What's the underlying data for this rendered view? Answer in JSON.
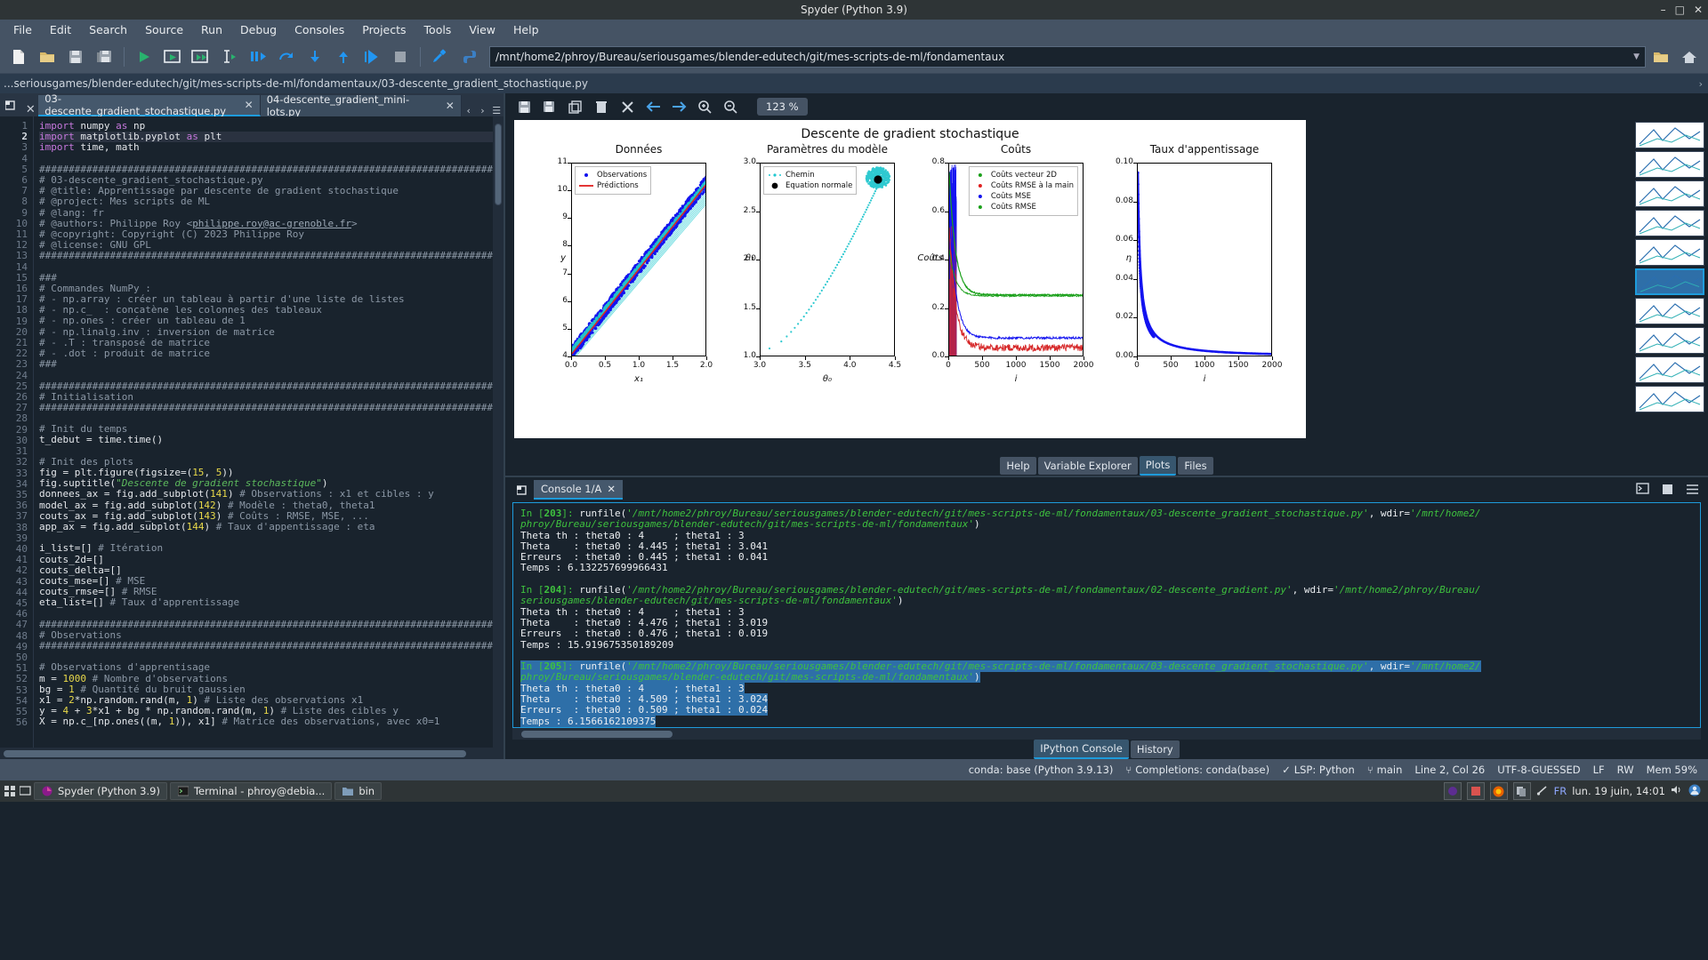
{
  "window": {
    "title": "Spyder (Python 3.9)",
    "minimize": "–",
    "maximize": "□",
    "close": "✕"
  },
  "menubar": {
    "items": [
      "File",
      "Edit",
      "Search",
      "Source",
      "Run",
      "Debug",
      "Consoles",
      "Projects",
      "Tools",
      "View",
      "Help"
    ]
  },
  "toolbar": {
    "icons": [
      "new-file",
      "open-file",
      "save-file",
      "save-all",
      "run-file",
      "run-cell",
      "run-cell-advance",
      "run-selection",
      "debug-file",
      "debug-step",
      "debug-continue",
      "debug-stop",
      "debug-exit",
      "preferences",
      "python-path"
    ],
    "path_value": "/mnt/home2/phroy/Bureau/seriousgames/blender-edutech/git/mes-scripts-de-ml/fondamentaux",
    "browse_label": "browse-directory",
    "home_label": "home-directory"
  },
  "pathstrip": {
    "text": "...seriousgames/blender-edutech/git/mes-scripts-de-ml/fondamentaux/03-descente_gradient_stochastique.py"
  },
  "editor": {
    "tabs": [
      {
        "label": "03-descente_gradient_stochastique.py",
        "active": true
      },
      {
        "label": "04-descente_gradient_mini-lots.py",
        "active": false
      }
    ],
    "current_line": 2,
    "lines": [
      {
        "n": 1,
        "html": "<span class='kw'>import</span> numpy <span class='kw'>as</span> np"
      },
      {
        "n": 2,
        "html": "<span class='kw'>import</span> matplotlib.pyplot <span class='kw'>as</span> plt"
      },
      {
        "n": 3,
        "html": "<span class='kw'>import</span> time, math"
      },
      {
        "n": 4,
        "html": ""
      },
      {
        "n": 5,
        "html": "<span class='cm'>###############################################################################</span>"
      },
      {
        "n": 6,
        "html": "<span class='cm'># 03-descente_gradient_stochastique.py</span>"
      },
      {
        "n": 7,
        "html": "<span class='cm'># @title: Apprentissage par descente de gradient stochastique</span>"
      },
      {
        "n": 8,
        "html": "<span class='cm'># @project: Mes scripts de ML</span>"
      },
      {
        "n": 9,
        "html": "<span class='cm'># @lang: fr</span>"
      },
      {
        "n": 10,
        "html": "<span class='cm'># @authors: Philippe Roy &lt;<span class='lnk'>philippe.roy@ac-grenoble.fr</span>&gt;</span>"
      },
      {
        "n": 11,
        "html": "<span class='cm'># @copyright: Copyright (C) 2023 Philippe Roy</span>"
      },
      {
        "n": 12,
        "html": "<span class='cm'># @license: GNU GPL</span>"
      },
      {
        "n": 13,
        "html": "<span class='cm'>###############################################################################</span>"
      },
      {
        "n": 14,
        "html": ""
      },
      {
        "n": 15,
        "html": "<span class='cm'>###</span>"
      },
      {
        "n": 16,
        "html": "<span class='cm'># Commandes NumPy :</span>"
      },
      {
        "n": 17,
        "html": "<span class='cm'># - np.array : créer un tableau à partir d'une liste de listes</span>"
      },
      {
        "n": 18,
        "html": "<span class='cm'># - np.c_  : concatène les colonnes des tableaux</span>"
      },
      {
        "n": 19,
        "html": "<span class='cm'># - np.ones : créer un tableau de 1</span>"
      },
      {
        "n": 20,
        "html": "<span class='cm'># - np.linalg.inv : inversion de matrice</span>"
      },
      {
        "n": 21,
        "html": "<span class='cm'># - .T : transposé de matrice</span>"
      },
      {
        "n": 22,
        "html": "<span class='cm'># - .dot : produit de matrice</span>"
      },
      {
        "n": 23,
        "html": "<span class='cm'>###</span>"
      },
      {
        "n": 24,
        "html": ""
      },
      {
        "n": 25,
        "html": "<span class='cm'>###############################################################################</span>"
      },
      {
        "n": 26,
        "html": "<span class='cm'># Initialisation</span>"
      },
      {
        "n": 27,
        "html": "<span class='cm'>###############################################################################</span>"
      },
      {
        "n": 28,
        "html": ""
      },
      {
        "n": 29,
        "html": "<span class='cm'># Init du temps</span>"
      },
      {
        "n": 30,
        "html": "t_debut = time.time()"
      },
      {
        "n": 31,
        "html": ""
      },
      {
        "n": 32,
        "html": "<span class='cm'># Init des plots</span>"
      },
      {
        "n": 33,
        "html": "fig = plt.figure(figsize=(<span class='num'>15</span>, <span class='num'>5</span>))"
      },
      {
        "n": 34,
        "html": "fig.suptitle(<span class='st'>\"Descente de gradient stochastique\"</span>)"
      },
      {
        "n": 35,
        "html": "donnees_ax = fig.add_subplot(<span class='num'>141</span>) <span class='cm'># Observations : x1 et cibles : y</span>"
      },
      {
        "n": 36,
        "html": "model_ax = fig.add_subplot(<span class='num'>142</span>) <span class='cm'># Modèle : theta0, theta1</span>"
      },
      {
        "n": 37,
        "html": "couts_ax = fig.add_subplot(<span class='num'>143</span>) <span class='cm'># Coûts : RMSE, MSE, ...</span>"
      },
      {
        "n": 38,
        "html": "app_ax = fig.add_subplot(<span class='num'>144</span>) <span class='cm'># Taux d'appentissage : eta</span>"
      },
      {
        "n": 39,
        "html": ""
      },
      {
        "n": 40,
        "html": "i_list=[] <span class='cm'># Itération</span>"
      },
      {
        "n": 41,
        "html": "couts_2d=[]"
      },
      {
        "n": 42,
        "html": "couts_delta=[]"
      },
      {
        "n": 43,
        "html": "couts_mse=[] <span class='cm'># MSE</span>"
      },
      {
        "n": 44,
        "html": "couts_rmse=[] <span class='cm'># RMSE</span>"
      },
      {
        "n": 45,
        "html": "eta_list=[] <span class='cm'># Taux d'apprentissage</span>"
      },
      {
        "n": 46,
        "html": ""
      },
      {
        "n": 47,
        "html": "<span class='cm'>###############################################################################</span>"
      },
      {
        "n": 48,
        "html": "<span class='cm'># Observations</span>"
      },
      {
        "n": 49,
        "html": "<span class='cm'>###############################################################################</span>"
      },
      {
        "n": 50,
        "html": ""
      },
      {
        "n": 51,
        "html": "<span class='cm'># Observations d'apprentisage</span>"
      },
      {
        "n": 52,
        "html": "m = <span class='num'>1000</span> <span class='cm'># Nombre d'observations</span>"
      },
      {
        "n": 53,
        "html": "bg = <span class='num'>1</span> <span class='cm'># Quantité du bruit gaussien</span>"
      },
      {
        "n": 54,
        "html": "x1 = <span class='num'>2</span>*np.random.rand(m, <span class='num'>1</span>) <span class='cm'># Liste des observations x1</span>"
      },
      {
        "n": 55,
        "html": "y = <span class='num'>4</span> + <span class='num'>3</span>*x1 + bg * np.random.rand(m, <span class='num'>1</span>) <span class='cm'># Liste des cibles y</span>"
      },
      {
        "n": 56,
        "html": "X = np.c_[np.ones((m, <span class='num'>1</span>)), x1] <span class='cm'># Matrice des observations, avec x0=1</span>"
      }
    ]
  },
  "plots": {
    "toolbar_icons": [
      "save-plot",
      "copy-plot",
      "duplicate-plot",
      "delete-plot",
      "delete-all-plots",
      "previous-plot",
      "next-plot",
      "zoom-in",
      "zoom-out"
    ],
    "zoom_level": "123 %",
    "tabs": [
      {
        "label": "Help",
        "active": false
      },
      {
        "label": "Variable Explorer",
        "active": false
      },
      {
        "label": "Plots",
        "active": true
      },
      {
        "label": "Files",
        "active": false
      }
    ]
  },
  "chart_data": [
    {
      "type": "scatter",
      "figure_title": "Descente de gradient stochastique",
      "title": "Données",
      "xlabel": "x₁",
      "ylabel": "y",
      "xlim": [
        0.0,
        2.0
      ],
      "ylim": [
        4,
        11
      ],
      "xticks": [
        "0.0",
        "0.5",
        "1.0",
        "1.5",
        "2.0"
      ],
      "yticks": [
        "4",
        "5",
        "6",
        "7",
        "8",
        "9",
        "10",
        "11"
      ],
      "legend": [
        {
          "label": "Observations",
          "marker": "point",
          "color": "#1010ee"
        },
        {
          "label": "Prédictions",
          "marker": "line",
          "color": "#e02020"
        }
      ],
      "legend_position": "upper left",
      "series": [
        {
          "name": "Observations",
          "color": "#1010ee",
          "description": "dense cloud of 1000 blue points y = 4 + 3*x1 + noise"
        },
        {
          "name": "Prédictions",
          "color": "#e02020",
          "description": "red regression line from (0,4.5) to (2,10.5)"
        },
        {
          "name": "Itérations",
          "color": "#20c0c0",
          "description": "cyan intermediate fit lines converging to the red line"
        }
      ]
    },
    {
      "type": "scatter",
      "title": "Paramètres du modèle",
      "xlabel": "θ₀",
      "ylabel": "θ₁",
      "xlim": [
        2.85,
        4.65
      ],
      "ylim": [
        0.85,
        3.15
      ],
      "xticks": [
        "3.0",
        "3.5",
        "4.0",
        "4.5"
      ],
      "yticks": [
        "1.0",
        "1.5",
        "2.0",
        "2.5",
        "3.0"
      ],
      "legend": [
        {
          "label": "Chemin",
          "marker": "dotted",
          "color": "#20c8d0"
        },
        {
          "label": "Equation normale",
          "marker": "bigdot",
          "color": "#000000"
        }
      ],
      "legend_position": "upper left",
      "series": [
        {
          "name": "Chemin",
          "color": "#20c8d0",
          "description": "cyan dotted path from (2.95,0.95) rising to (4.5,3.02)"
        },
        {
          "name": "Equation normale",
          "color": "#000000",
          "description": "black dot at (4.51, 3.02)"
        }
      ]
    },
    {
      "type": "line",
      "title": "Coûts",
      "xlabel": "i",
      "ylabel": "Coûts",
      "xlim": [
        0,
        2000
      ],
      "ylim": [
        0.0,
        0.9
      ],
      "xticks": [
        "0",
        "500",
        "1000",
        "1500",
        "2000"
      ],
      "yticks": [
        "0.0",
        "0.2",
        "0.4",
        "0.6",
        "0.8"
      ],
      "legend": [
        {
          "label": "Coûts vecteur 2D",
          "color": "#1aa01a"
        },
        {
          "label": "Coûts RMSE à la main",
          "color": "#e02020"
        },
        {
          "label": "Coûts MSE",
          "color": "#1010ee"
        },
        {
          "label": "Coûts RMSE",
          "color": "#1aa01a"
        }
      ],
      "legend_position": "upper right",
      "series": [
        {
          "name": "Coûts vecteur 2D",
          "color": "#1aa01a",
          "description": "decays from 0.85 to plateau ~0.29"
        },
        {
          "name": "Coûts RMSE à la main",
          "color": "#e02020",
          "description": "decays to noisy band ~0.02-0.10"
        },
        {
          "name": "Coûts MSE",
          "color": "#1010ee",
          "description": "decays to ~0.09 plateau"
        },
        {
          "name": "Coûts RMSE",
          "color": "#1aa01a",
          "description": "overlaps vecteur 2D plateau ~0.29"
        }
      ]
    },
    {
      "type": "line",
      "title": "Taux d'appentissage",
      "xlabel": "i",
      "ylabel": "η",
      "xlim": [
        0,
        2000
      ],
      "ylim": [
        0.0,
        0.105
      ],
      "xticks": [
        "0",
        "500",
        "1000",
        "1500",
        "2000"
      ],
      "yticks": [
        "0.00",
        "0.02",
        "0.04",
        "0.06",
        "0.08",
        "0.10"
      ],
      "series": [
        {
          "name": "eta",
          "color": "#1010ee",
          "description": "hyperbolic decay from 0.10 at i=0 down to ~0.002 at i=2000"
        }
      ]
    }
  ],
  "console": {
    "tab_label": "Console 1/A",
    "icons": [
      "new-console",
      "options",
      "browse-tabs"
    ],
    "lines": [
      {
        "html": "<span class='cprompt'>In [</span><span class='cnum'>203</span><span class='cprompt'>]:</span> runfile(<span class='cpath'>'/mnt/home2/phroy/Bureau/seriousgames/blender-edutech/git/mes-scripts-de-ml/fondamentaux/03-descente_gradient_stochastique.py'</span>, wdir=<span class='cpath'>'/mnt/home2/</span>"
      },
      {
        "html": "<span class='cpath'>phroy/Bureau/seriousgames/blender-edutech/git/mes-scripts-de-ml/fondamentaux'</span>)"
      },
      {
        "html": "Theta th : theta0 : 4     ; theta1 : 3"
      },
      {
        "html": "Theta    : theta0 : 4.445 ; theta1 : 3.041"
      },
      {
        "html": "Erreurs  : theta0 : 0.445 ; theta1 : 0.041"
      },
      {
        "html": "Temps : 6.132257699966431"
      },
      {
        "html": ""
      },
      {
        "html": "<span class='cprompt'>In [</span><span class='cnum'>204</span><span class='cprompt'>]:</span> runfile(<span class='cpath'>'/mnt/home2/phroy/Bureau/seriousgames/blender-edutech/git/mes-scripts-de-ml/fondamentaux/02-descente_gradient.py'</span>, wdir=<span class='cpath'>'/mnt/home2/phroy/Bureau/</span>"
      },
      {
        "html": "<span class='cpath'>seriousgames/blender-edutech/git/mes-scripts-de-ml/fondamentaux'</span>)"
      },
      {
        "html": "Theta th : theta0 : 4     ; theta1 : 3"
      },
      {
        "html": "Theta    : theta0 : 4.476 ; theta1 : 3.019"
      },
      {
        "html": "Erreurs  : theta0 : 0.476 ; theta1 : 0.019"
      },
      {
        "html": "Temps : 15.919675350189209"
      },
      {
        "html": ""
      },
      {
        "html": "<span class='sel'><span class='cprompt'>In [</span><span class='cnum'>205</span><span class='cprompt'>]:</span> runfile(<span class='cpath'>'/mnt/home2/phroy/Bureau/seriousgames/blender-edutech/git/mes-scripts-de-ml/fondamentaux/03-descente_gradient_stochastique.py'</span>, wdir=<span class='cpath'>'/mnt/home2/</span></span>"
      },
      {
        "html": "<span class='sel'><span class='cpath'>phroy/Bureau/seriousgames/blender-edutech/git/mes-scripts-de-ml/fondamentaux'</span>)</span>"
      },
      {
        "html": "<span class='sel'>Theta th : theta0 : 4     ; theta1 : 3</span>"
      },
      {
        "html": "<span class='sel'>Theta    : theta0 : 4.509 ; theta1 : 3.024</span>"
      },
      {
        "html": "<span class='sel'>Erreurs  : theta0 : 0.509 ; theta1 : 0.024</span>"
      },
      {
        "html": "<span class='sel'>Temps : 6.1566162109375</span>"
      }
    ],
    "bottom_tabs": [
      {
        "label": "IPython Console",
        "active": true
      },
      {
        "label": "History",
        "active": false
      }
    ]
  },
  "statusbar": {
    "conda": "conda: base (Python 3.9.13)",
    "completions": "Completions: conda(base)",
    "lsp": "LSP: Python",
    "branch": "main",
    "cursor": "Line 2, Col 26",
    "encoding": "UTF-8-GUESSED",
    "eol": "LF",
    "rw": "RW",
    "memory": "Mem 59%"
  },
  "taskbar": {
    "apps": [
      {
        "label": "Spyder (Python 3.9)",
        "icon": "spyder-icon"
      },
      {
        "label": "Terminal - phroy@debia...",
        "icon": "terminal-icon"
      },
      {
        "label": "bin",
        "icon": "folder-icon"
      }
    ],
    "tray_icons": [
      "app-tray-1",
      "app-tray-2",
      "firefox-icon",
      "files-icon",
      "network-icon"
    ],
    "language": "FR",
    "clock": "lun. 19 juin, 14:01",
    "volume_icon": "volume-icon",
    "user_icon": "user-icon"
  }
}
